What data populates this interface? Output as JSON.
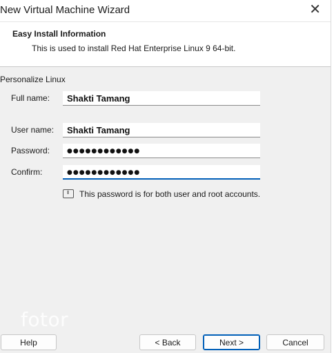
{
  "window": {
    "title": "New Virtual Machine Wizard",
    "close_glyph": "✕"
  },
  "header": {
    "title": "Easy Install Information",
    "subtitle": "This is used to install Red Hat Enterprise Linux 9 64-bit."
  },
  "personalize": {
    "group_label": "Personalize Linux",
    "full_name_label": "Full name:",
    "full_name_value": "Shakti Tamang",
    "user_name_label": "User name:",
    "user_name_value": "Shakti Tamang",
    "password_label": "Password:",
    "password_value": "●●●●●●●●●●●●",
    "confirm_label": "Confirm:",
    "confirm_value": "●●●●●●●●●●●●"
  },
  "info": {
    "icon": "info-icon",
    "text": "This password is for both user and root accounts."
  },
  "watermark": "fotor",
  "buttons": {
    "help": "Help",
    "back": "< Back",
    "next": "Next >",
    "cancel": "Cancel"
  }
}
